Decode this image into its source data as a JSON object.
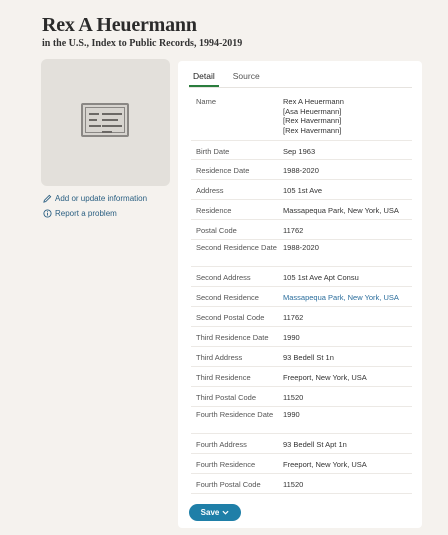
{
  "header": {
    "title": "Rex A Heuermann",
    "subtitle": "in the U.S., Index to Public Records, 1994-2019"
  },
  "sidebar": {
    "thumbnail_icon": "record-card-icon",
    "links": [
      {
        "label": "Add or update information",
        "icon": "pencil-icon"
      },
      {
        "label": "Report a problem",
        "icon": "info-icon"
      }
    ]
  },
  "tabs": [
    {
      "label": "Detail",
      "active": true
    },
    {
      "label": "Source",
      "active": false
    }
  ],
  "details": [
    {
      "label": "Name",
      "value": "Rex A Heuermann\n[Asa Heuermann]\n[Rex Havermann]\n[Rex Havermann]"
    },
    {
      "label": "Birth Date",
      "value": "Sep 1963"
    },
    {
      "label": "Residence Date",
      "value": "1988-2020"
    },
    {
      "label": "Address",
      "value": "105 1st Ave"
    },
    {
      "label": "Residence",
      "value": "Massapequa Park, New York, USA"
    },
    {
      "label": "Postal Code",
      "value": "11762"
    },
    {
      "label": "Second Residence Date",
      "value": "1988-2020"
    },
    {
      "label": "Second Address",
      "value": "105 1st Ave Apt Consu"
    },
    {
      "label": "Second Residence",
      "value": "Massapequa Park, New York, USA",
      "link": true
    },
    {
      "label": "Second Postal Code",
      "value": "11762"
    },
    {
      "label": "Third Residence Date",
      "value": "1990"
    },
    {
      "label": "Third Address",
      "value": "93 Bedell St 1n"
    },
    {
      "label": "Third Residence",
      "value": "Freeport, New York, USA"
    },
    {
      "label": "Third Postal Code",
      "value": "11520"
    },
    {
      "label": "Fourth Residence Date",
      "value": "1990"
    },
    {
      "label": "Fourth Address",
      "value": "93 Bedell St Apt 1n"
    },
    {
      "label": "Fourth Residence",
      "value": "Freeport, New York, USA"
    },
    {
      "label": "Fourth Postal Code",
      "value": "11520"
    }
  ],
  "save_button": {
    "label": "Save",
    "icon": "chevron-down-icon"
  },
  "colors": {
    "background": "#f5f2ee",
    "accent_tab": "#2a7d3d",
    "link": "#2a6d9c",
    "save_button": "#1f7fa8"
  }
}
